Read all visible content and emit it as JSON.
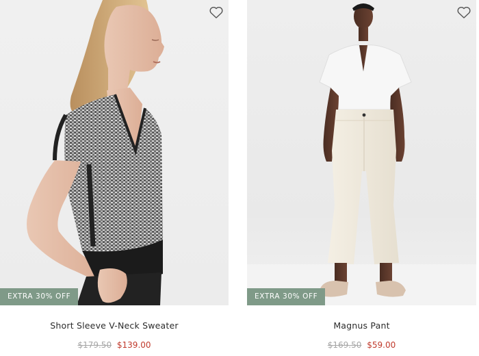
{
  "products": [
    {
      "name": "Short Sleeve V-Neck Sweater",
      "promo": "EXTRA 30% OFF",
      "original_price": "$179.50",
      "sale_price": "$139.00",
      "wishlist_icon": "heart-outline-icon"
    },
    {
      "name": "Magnus Pant",
      "promo": "EXTRA 30% OFF",
      "original_price": "$169.50",
      "sale_price": "$59.00",
      "wishlist_icon": "heart-outline-icon"
    }
  ],
  "colors": {
    "promo_badge": "#7f9a88",
    "sale_price": "#c0392b",
    "original_price": "#a6a6a6"
  }
}
